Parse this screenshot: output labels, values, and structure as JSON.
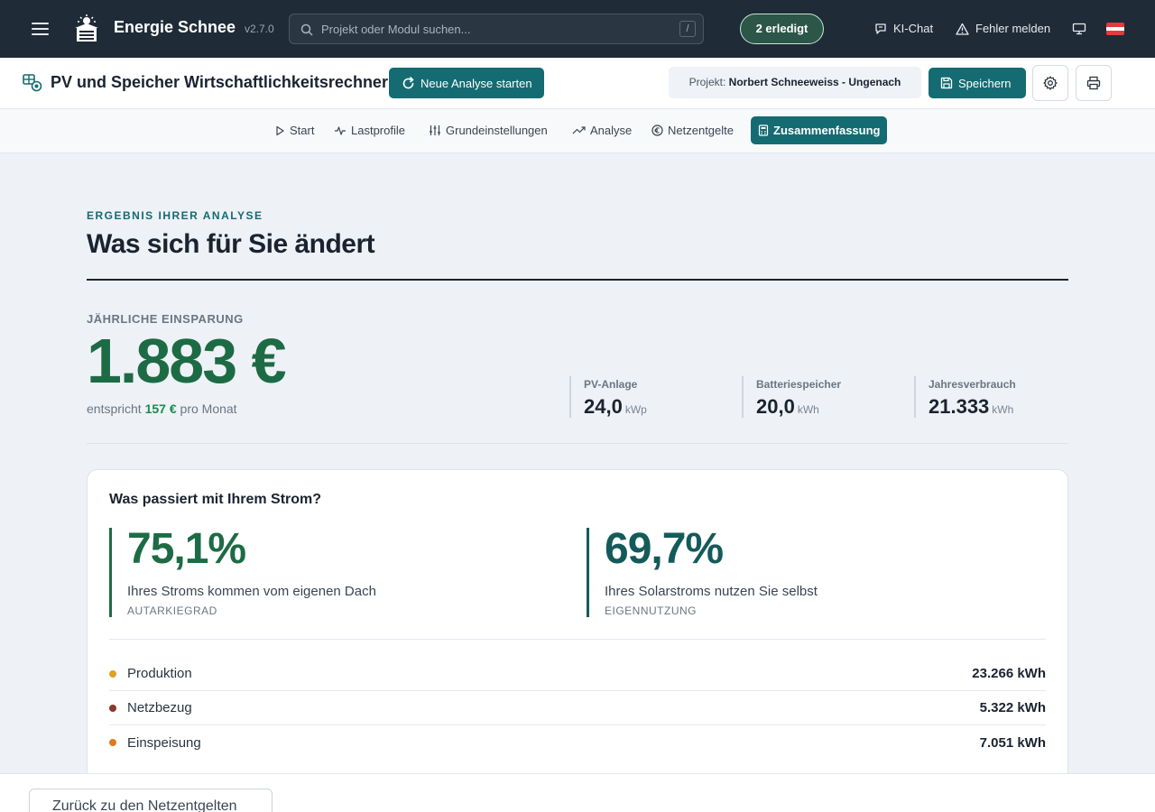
{
  "topbar": {
    "brand": "Energie Schnee",
    "version": "v2.7.0",
    "search_placeholder": "Projekt oder Modul suchen...",
    "search_shortcut": "/",
    "done_pill": "2 erledigt",
    "ki_chat": "KI-Chat",
    "report_error": "Fehler melden",
    "icons": [
      "menu-icon",
      "logo-icon",
      "search-icon",
      "chat-icon",
      "warning-icon",
      "monitor-icon",
      "austria-flag-icon"
    ]
  },
  "header": {
    "title": "PV und Speicher Wirtschaftlichkeitsrechner",
    "new_analysis": "Neue Analyse starten",
    "project_prefix": "Projekt:",
    "project_name": "Norbert Schneeweiss - Ungenach",
    "save": "Speichern"
  },
  "tabs": [
    {
      "label": "Start",
      "icon": "play-icon"
    },
    {
      "label": "Lastprofile",
      "icon": "pulse-icon"
    },
    {
      "label": "Grundeinstellungen",
      "icon": "sliders-icon"
    },
    {
      "label": "Analyse",
      "icon": "trend-icon"
    },
    {
      "label": "Netzentgelte",
      "icon": "euro-icon"
    },
    {
      "label": "Zusammenfassung",
      "icon": "calculator-icon",
      "active": true
    }
  ],
  "main": {
    "eyebrow": "ERGEBNIS IHRER ANALYSE",
    "headline": "Was sich für Sie ändert",
    "savings_label": "JÄHRLICHE EINSPARUNG",
    "savings_value": "1.883 €",
    "month_prefix": "entspricht",
    "month_value": "157 €",
    "month_suffix": "pro Monat",
    "kpis": [
      {
        "label": "PV-Anlage",
        "value": "24,0",
        "unit": "kWp"
      },
      {
        "label": "Batteriespeicher",
        "value": "20,0",
        "unit": "kWh"
      },
      {
        "label": "Jahresverbrauch",
        "value": "21.333",
        "unit": "kWh"
      }
    ]
  },
  "card": {
    "title": "Was passiert mit Ihrem Strom?",
    "autarky": {
      "value": "75,1%",
      "desc": "Ihres Stroms kommen vom eigenen Dach",
      "tag": "AUTARKIEGRAD"
    },
    "self_use": {
      "value": "69,7%",
      "desc": "Ihres Solarstroms nutzen Sie selbst",
      "tag": "EIGENNUTZUNG"
    },
    "flows": [
      {
        "label": "Produktion",
        "value": "23.266 kWh",
        "color": "#e0a020"
      },
      {
        "label": "Netzbezug",
        "value": "5.322 kWh",
        "color": "#8a3a2a"
      },
      {
        "label": "Einspeisung",
        "value": "7.051 kWh",
        "color": "#e07a20"
      }
    ]
  },
  "footer": {
    "back": "Zurück zu den Netzentgelten"
  },
  "colors": {
    "topbar": "#1f2b36",
    "accent": "#156b72",
    "green": "#1d6b45"
  }
}
